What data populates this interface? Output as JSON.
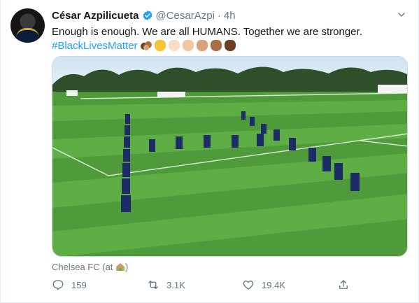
{
  "tweet": {
    "display_name": "César Azpilicueta",
    "handle": "@CesarAzpi",
    "separator": "·",
    "time": "4h",
    "text_main": "Enough is enough. We are all HUMANS. Together we are stronger.",
    "hashtag": "#BlackLivesMatter",
    "emoji_icons": [
      "fists-icon",
      "raised-fist-icon"
    ],
    "raised_fist_skin_tones": [
      "#f7c338",
      "#fbdcc4",
      "#f3c6a2",
      "#d9a27a",
      "#a86e48",
      "#6b4026"
    ],
    "location_text": "Chelsea FC (at ",
    "location_close": ")"
  },
  "actions": {
    "reply_count": "159",
    "retweet_count": "3.1K",
    "like_count": "19.4K"
  },
  "colors": {
    "link": "#1da1f2",
    "secondary_text": "#657786",
    "verified_badge": "#1da1f2"
  }
}
